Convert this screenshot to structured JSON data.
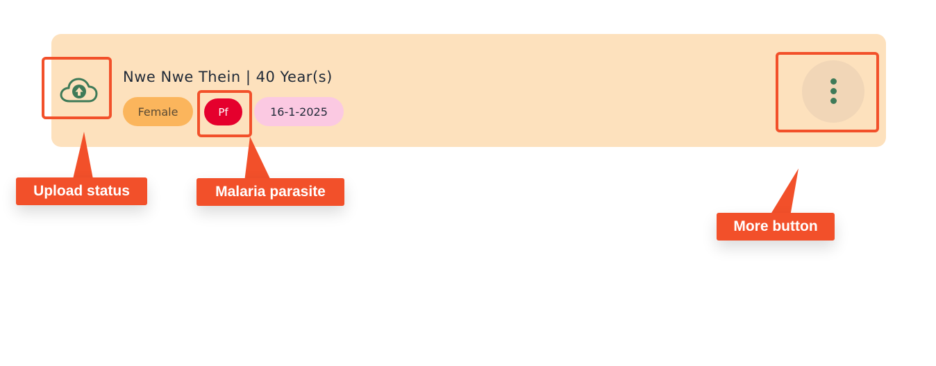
{
  "patient": {
    "name_age": "Nwe Nwe Thein | 40 Year(s)",
    "gender": "Female",
    "parasite": "Pf",
    "date": "16-1-2025"
  },
  "icons": {
    "upload_status": "cloud-upload-icon",
    "more": "vertical-ellipsis-icon"
  },
  "callouts": {
    "upload_status": "Upload status",
    "malaria_parasite": "Malaria parasite",
    "more_button": "More button"
  },
  "colors": {
    "card_background": "#fde1bd",
    "gender_badge": "#fbb55c",
    "parasite_badge": "#e5002d",
    "date_badge": "#fbc9e2",
    "icon_green": "#3e7a58",
    "annotation": "#f2502a"
  }
}
